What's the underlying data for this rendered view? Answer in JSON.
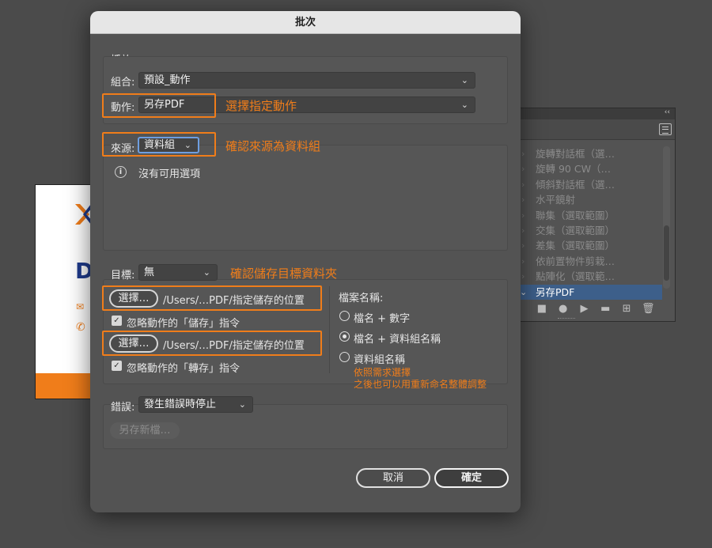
{
  "dialog": {
    "title": "批次",
    "play_section": "播放",
    "set_label": "組合:",
    "set_value": "預設_動作",
    "action_label": "動作:",
    "action_value": "另存PDF",
    "source_label": "來源:",
    "source_value": "資料組",
    "no_options": "沒有可用選項",
    "dest_label": "目標:",
    "dest_value": "無",
    "choose_label_1": "選擇…",
    "path_1": "/Users/…PDF/指定儲存的位置",
    "ignore_save": "忽略動作的「儲存」指令",
    "choose_label_2": "選擇…",
    "path_2": "/Users/…PDF/指定儲存的位置",
    "ignore_export": "忽略動作的「轉存」指令",
    "filename_heading": "檔案名稱:",
    "radio_1": "檔名 + 數字",
    "radio_2": "檔名 + 資料組名稱",
    "radio_3": "資料組名稱",
    "error_label": "錯誤:",
    "error_value": "發生錯誤時停止",
    "save_as_label": "另存新檔…",
    "cancel_label": "取消",
    "ok_label": "確定"
  },
  "annotations": {
    "action": "選擇指定動作",
    "source": "確認來源為資料組",
    "dest": "確認儲存目標資料夾",
    "filename_line1": "依照需求選擇",
    "filename_line2": "之後也可以用重新命名整體調整",
    "color": "#f07d1a"
  },
  "actions_panel": {
    "items": [
      "旋轉對話框（選…",
      "旋轉 90 CW（…",
      "傾斜對話框（選…",
      "水平鏡射",
      "聯集（選取範圍）",
      "交集（選取範圍）",
      "差集（選取範圍）",
      "依前置物件剪栽…",
      "點陣化（選取範…",
      "另存PDF"
    ],
    "selected_index": 9
  },
  "colors": {
    "dialog_bg": "#535353",
    "highlight": "#f07d1a",
    "focus_ring": "#6e9ee0",
    "selection": "#3d5f8a"
  }
}
